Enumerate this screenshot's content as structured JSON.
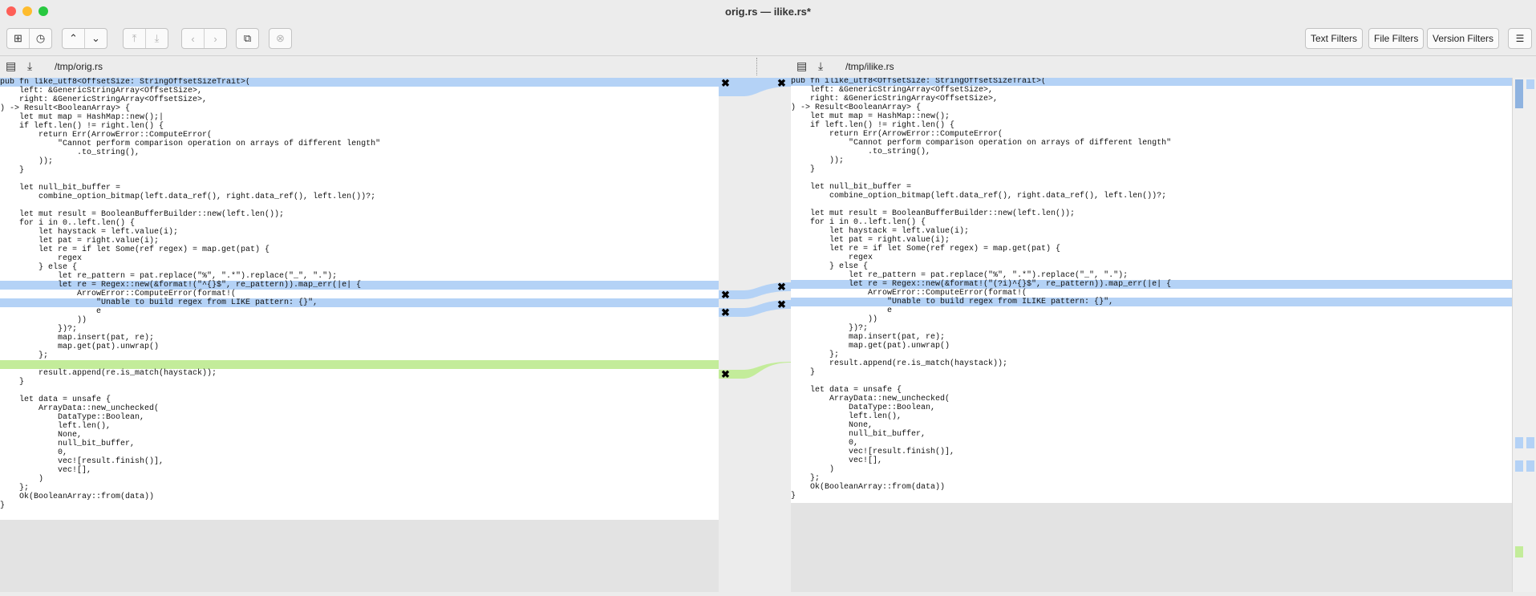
{
  "window": {
    "title": "orig.rs — ilike.rs*"
  },
  "toolbar": {
    "buttons": [
      {
        "name": "new-comparison-icon",
        "glyph": "⊞"
      },
      {
        "name": "history-icon",
        "glyph": "◷"
      },
      {
        "name": "prev-difference-icon",
        "glyph": "⌃"
      },
      {
        "name": "next-difference-icon",
        "glyph": "⌄"
      },
      {
        "name": "first-difference-icon",
        "glyph": "⤒"
      },
      {
        "name": "last-difference-icon",
        "glyph": "⤓"
      },
      {
        "name": "back-icon",
        "glyph": "‹"
      },
      {
        "name": "forward-icon",
        "glyph": "›"
      },
      {
        "name": "swap-sides-icon",
        "glyph": "⧉"
      },
      {
        "name": "stop-icon",
        "glyph": "⊗"
      }
    ],
    "text_filters": "Text Filters",
    "file_filters": "File Filters",
    "version_filters": "Version Filters",
    "menu_glyph": "☰"
  },
  "left": {
    "path": "/tmp/orig.rs",
    "lines": [
      "pub fn like_utf8<OffsetSize: StringOffsetSizeTrait>(",
      "    left: &GenericStringArray<OffsetSize>,",
      "    right: &GenericStringArray<OffsetSize>,",
      ") -> Result<BooleanArray> {",
      "    let mut map = HashMap::new();|",
      "    if left.len() != right.len() {",
      "        return Err(ArrowError::ComputeError(",
      "            \"Cannot perform comparison operation on arrays of different length\"",
      "                .to_string(),",
      "        ));",
      "    }",
      "",
      "    let null_bit_buffer =",
      "        combine_option_bitmap(left.data_ref(), right.data_ref(), left.len())?;",
      "",
      "    let mut result = BooleanBufferBuilder::new(left.len());",
      "    for i in 0..left.len() {",
      "        let haystack = left.value(i);",
      "        let pat = right.value(i);",
      "        let re = if let Some(ref regex) = map.get(pat) {",
      "            regex",
      "        } else {",
      "            let re_pattern = pat.replace(\"%\", \".*\").replace(\"_\", \".\");",
      "            let re = Regex::new(&format!(\"^{}$\", re_pattern)).map_err(|e| {",
      "                ArrowError::ComputeError(format!(",
      "                    \"Unable to build regex from LIKE pattern: {}\",",
      "                    e",
      "                ))",
      "            })?;",
      "            map.insert(pat, re);",
      "            map.get(pat).unwrap()",
      "        };",
      "",
      "        result.append(re.is_match(haystack));",
      "    }",
      "",
      "    let data = unsafe {",
      "        ArrayData::new_unchecked(",
      "            DataType::Boolean,",
      "            left.len(),",
      "            None,",
      "            null_bit_buffer,",
      "            0,",
      "            vec![result.finish()],",
      "            vec![],",
      "        )",
      "    };",
      "    Ok(BooleanArray::from(data))",
      "}"
    ]
  },
  "right": {
    "path": "/tmp/ilike.rs",
    "lines": [
      "pub fn ilike_utf8<OffsetSize: StringOffsetSizeTrait>(",
      "    left: &GenericStringArray<OffsetSize>,",
      "    right: &GenericStringArray<OffsetSize>,",
      ") -> Result<BooleanArray> {",
      "    let mut map = HashMap::new();",
      "    if left.len() != right.len() {",
      "        return Err(ArrowError::ComputeError(",
      "            \"Cannot perform comparison operation on arrays of different length\"",
      "                .to_string(),",
      "        ));",
      "    }",
      "",
      "    let null_bit_buffer =",
      "        combine_option_bitmap(left.data_ref(), right.data_ref(), left.len())?;",
      "",
      "    let mut result = BooleanBufferBuilder::new(left.len());",
      "    for i in 0..left.len() {",
      "        let haystack = left.value(i);",
      "        let pat = right.value(i);",
      "        let re = if let Some(ref regex) = map.get(pat) {",
      "            regex",
      "        } else {",
      "            let re_pattern = pat.replace(\"%\", \".*\").replace(\"_\", \".\");",
      "            let re = Regex::new(&format!(\"(?i)^{}$\", re_pattern)).map_err(|e| {",
      "                ArrowError::ComputeError(format!(",
      "                    \"Unable to build regex from ILIKE pattern: {}\",",
      "                    e",
      "                ))",
      "            })?;",
      "            map.insert(pat, re);",
      "            map.get(pat).unwrap()",
      "        };",
      "        result.append(re.is_match(haystack));",
      "    }",
      "",
      "    let data = unsafe {",
      "        ArrayData::new_unchecked(",
      "            DataType::Boolean,",
      "            left.len(),",
      "            None,",
      "            null_bit_buffer,",
      "            0,",
      "            vec![result.finish()],",
      "            vec![],",
      "        )",
      "    };",
      "    Ok(BooleanArray::from(data))",
      "}"
    ]
  },
  "diff": {
    "changed_left_lines": [
      0,
      23,
      25
    ],
    "changed_right_lines": [
      0,
      23,
      25
    ],
    "removed_left_lines": [
      32
    ],
    "change_color": "#b4d2f6",
    "removal_color": "#c3ec9a",
    "merge_glyph": "✖"
  }
}
